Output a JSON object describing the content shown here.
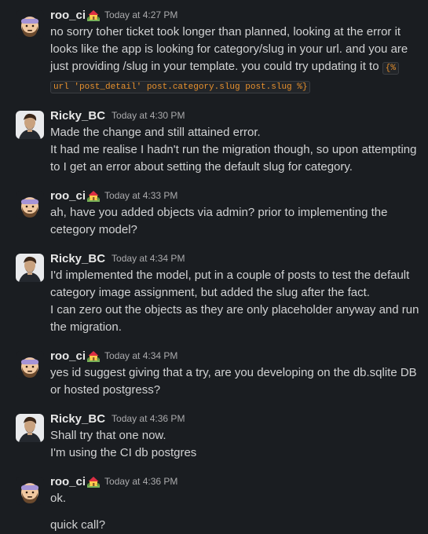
{
  "colors": {
    "background": "#1a1d21",
    "text": "#d1d2d3",
    "author": "#e8e8e8",
    "timestamp": "#ababad",
    "code_text": "#e8912d",
    "code_background": "#222529"
  },
  "messages": [
    {
      "author": "roo_ci",
      "avatar": "bearded-man-beanie-avatar",
      "status_icon": "house-with-garden-icon",
      "time": "Today at 4:27 PM",
      "lines": [
        "no sorry toher ticket took longer than planned, looking at the error it",
        "looks like the app is looking for category/slug in your url. and you are",
        "just providing /slug in your template. you could try updating it to ",
        "url 'post_detail' post.category.slug post.slug %}"
      ],
      "code_part1": "{%",
      "code_part2": "url 'post_detail' post.category.slug post.slug %}"
    },
    {
      "author": "Ricky_BC",
      "avatar": "photo-avatar",
      "time": "Today at 4:30 PM",
      "lines": [
        "Made the change and still attained error.",
        "It had me realise I hadn't run the migration though, so upon attempting",
        "to I get an error about setting the default slug for category."
      ]
    },
    {
      "author": "roo_ci",
      "avatar": "bearded-man-beanie-avatar",
      "status_icon": "house-with-garden-icon",
      "time": "Today at 4:33 PM",
      "lines": [
        "ah, have you added objects via admin? prior to implementing the",
        "cetegory model?"
      ]
    },
    {
      "author": "Ricky_BC",
      "avatar": "photo-avatar",
      "time": "Today at 4:34 PM",
      "lines": [
        "I'd implemented the model, put in a couple of posts to test the default",
        "category image assignment, but added the slug after the fact.",
        "I can zero out the objects as they are only placeholder anyway and run",
        "the migration."
      ]
    },
    {
      "author": "roo_ci",
      "avatar": "bearded-man-beanie-avatar",
      "status_icon": "house-with-garden-icon",
      "time": "Today at 4:34 PM",
      "lines": [
        "yes id suggest giving that a try, are you developing on the db.sqlite DB",
        "or hosted postgress?"
      ]
    },
    {
      "author": "Ricky_BC",
      "avatar": "photo-avatar",
      "time": "Today at 4:36 PM",
      "lines": [
        "Shall try that one now.",
        "I'm using the CI db postgres"
      ]
    },
    {
      "author": "roo_ci",
      "avatar": "bearded-man-beanie-avatar",
      "status_icon": "house-with-garden-icon",
      "time": "Today at 4:36 PM",
      "lines": [
        "ok.",
        "quick call?"
      ]
    }
  ]
}
